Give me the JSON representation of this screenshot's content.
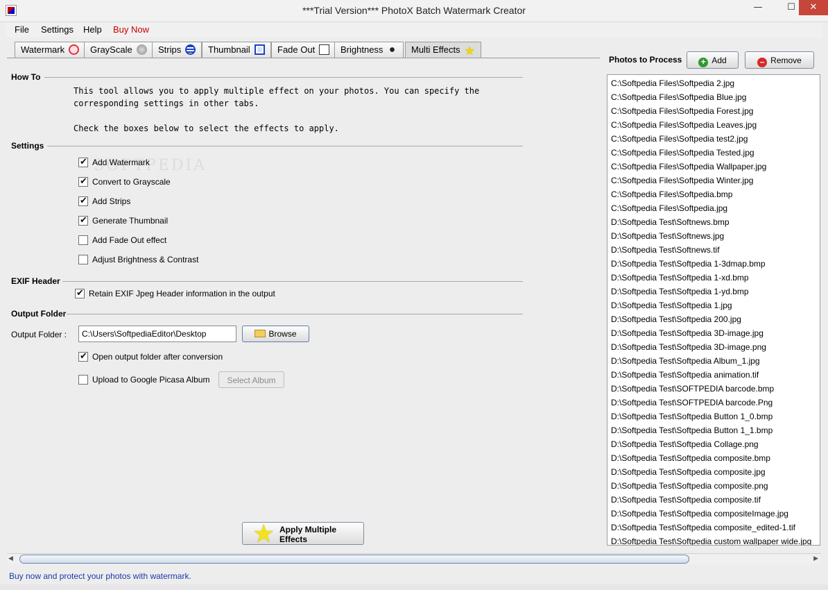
{
  "window": {
    "title": "***Trial Version*** PhotoX Batch Watermark Creator",
    "minimize": "—",
    "maximize": "☐",
    "close": "✕"
  },
  "menu": {
    "file": "File",
    "settings": "Settings",
    "help": "Help",
    "buy_now": "Buy Now"
  },
  "tabs": [
    {
      "label": "Watermark",
      "icon": "watermark-icon"
    },
    {
      "label": "GrayScale",
      "icon": "grayscale-icon"
    },
    {
      "label": "Strips",
      "icon": "strips-icon"
    },
    {
      "label": "Thumbnail",
      "icon": "thumbnail-icon"
    },
    {
      "label": "Fade Out",
      "icon": "fade-out-icon"
    },
    {
      "label": "Brightness",
      "icon": "brightness-icon"
    },
    {
      "label": "Multi Effects",
      "icon": "star-icon",
      "active": true
    }
  ],
  "how_to": {
    "heading": "How To",
    "line1": "This tool allows you to apply multiple effect on your photos. You can specify the",
    "line2": "corresponding settings in other tabs.",
    "line3": "Check the boxes below to select the effects to apply."
  },
  "settings": {
    "heading": "Settings",
    "options": [
      {
        "label": "Add Watermark",
        "checked": true
      },
      {
        "label": "Convert to Grayscale",
        "checked": true
      },
      {
        "label": "Add Strips",
        "checked": true
      },
      {
        "label": "Generate Thumbnail",
        "checked": true
      },
      {
        "label": "Add Fade Out effect",
        "checked": false
      },
      {
        "label": "Adjust Brightness & Contrast",
        "checked": false
      }
    ]
  },
  "exif": {
    "heading": "EXIF Header",
    "retain_label": "Retain EXIF Jpeg Header information in the output",
    "retain_checked": true
  },
  "output": {
    "heading": "Output Folder",
    "label": "Output Folder :",
    "path": "C:\\Users\\SoftpediaEditor\\Desktop",
    "browse": "Browse",
    "open_after_label": "Open output folder after conversion",
    "open_after_checked": true,
    "upload_label": "Upload to Google Picasa Album",
    "upload_checked": false,
    "select_album": "Select Album"
  },
  "apply": {
    "line1": "Apply Multiple",
    "line2": "Effects"
  },
  "watermark_text": "SOFTPEDIA",
  "photos": {
    "label": "Photos to Process",
    "add": "Add",
    "remove": "Remove",
    "files": [
      "C:\\Softpedia Files\\Softpedia 2.jpg",
      "C:\\Softpedia Files\\Softpedia Blue.jpg",
      "C:\\Softpedia Files\\Softpedia Forest.jpg",
      "C:\\Softpedia Files\\Softpedia Leaves.jpg",
      "C:\\Softpedia Files\\Softpedia test2.jpg",
      "C:\\Softpedia Files\\Softpedia Tested.jpg",
      "C:\\Softpedia Files\\Softpedia Wallpaper.jpg",
      "C:\\Softpedia Files\\Softpedia Winter.jpg",
      "C:\\Softpedia Files\\Softpedia.bmp",
      "C:\\Softpedia Files\\Softpedia.jpg",
      "D:\\Softpedia Test\\Softnews.bmp",
      "D:\\Softpedia Test\\Softnews.jpg",
      "D:\\Softpedia Test\\Softnews.tif",
      "D:\\Softpedia Test\\Softpedia 1-3dmap.bmp",
      "D:\\Softpedia Test\\Softpedia 1-xd.bmp",
      "D:\\Softpedia Test\\Softpedia 1-yd.bmp",
      "D:\\Softpedia Test\\Softpedia 1.jpg",
      "D:\\Softpedia Test\\Softpedia 200.jpg",
      "D:\\Softpedia Test\\Softpedia 3D-image.jpg",
      "D:\\Softpedia Test\\Softpedia 3D-image.png",
      "D:\\Softpedia Test\\Softpedia Album_1.jpg",
      "D:\\Softpedia Test\\Softpedia animation.tif",
      "D:\\Softpedia Test\\SOFTPEDIA barcode.bmp",
      "D:\\Softpedia Test\\SOFTPEDIA barcode.Png",
      "D:\\Softpedia Test\\Softpedia Button 1_0.bmp",
      "D:\\Softpedia Test\\Softpedia Button 1_1.bmp",
      "D:\\Softpedia Test\\Softpedia Collage.png",
      "D:\\Softpedia Test\\Softpedia composite.bmp",
      "D:\\Softpedia Test\\Softpedia composite.jpg",
      "D:\\Softpedia Test\\Softpedia composite.png",
      "D:\\Softpedia Test\\Softpedia composite.tif",
      "D:\\Softpedia Test\\Softpedia compositeImage.jpg",
      "D:\\Softpedia Test\\Softpedia composite_edited-1.tif",
      "D:\\Softpedia Test\\Softpedia custom wallpaper wide.jpg"
    ]
  },
  "status": "Buy now and protect your photos with watermark."
}
